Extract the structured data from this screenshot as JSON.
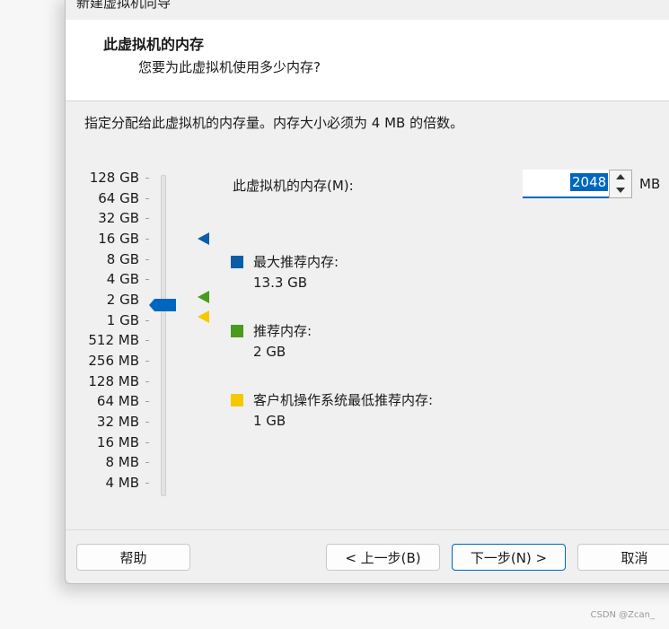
{
  "window": {
    "title": "新建虚拟机向导"
  },
  "header": {
    "title": "此虚拟机的内存",
    "subtitle": "您要为此虚拟机使用多少内存?"
  },
  "instruction": "指定分配给此虚拟机的内存量。内存大小必须为 4 MB 的倍数。",
  "scale": {
    "labels": [
      "128 GB",
      "64 GB",
      "32 GB",
      "16 GB",
      "8 GB",
      "4 GB",
      "2 GB",
      "1 GB",
      "512 MB",
      "256 MB",
      "128 MB",
      "64 MB",
      "32 MB",
      "16 MB",
      "8 MB",
      "4 MB"
    ],
    "selected": "2 GB"
  },
  "memory": {
    "label": "此虚拟机的内存(M):",
    "value": "2048",
    "unit": "MB"
  },
  "legend": [
    {
      "label": "最大推荐内存:",
      "value": "13.3 GB",
      "color": "#0a5ea8"
    },
    {
      "label": "推荐内存:",
      "value": "2 GB",
      "color": "#4a9a1e"
    },
    {
      "label": "客户机操作系统最低推荐内存:",
      "value": "1 GB",
      "color": "#f5c800"
    }
  ],
  "buttons": {
    "help": "帮助",
    "back": "< 上一步(B)",
    "next": "下一步(N) >",
    "cancel": "取消"
  },
  "watermark": "CSDN @Zcan_"
}
